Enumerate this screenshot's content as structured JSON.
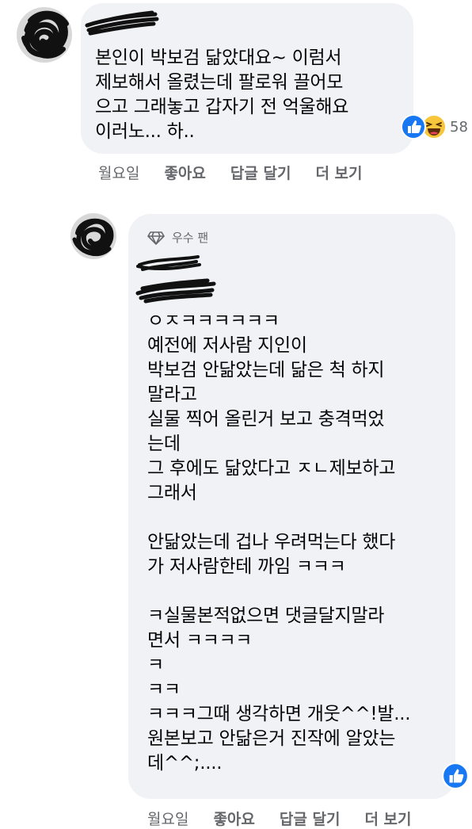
{
  "comments": [
    {
      "text": "본인이 박보검 닮았대요~ 이럼서\n제보해서 올렸는데 팔로워 끌어모\n으고 그래놓고 갑자기 전 억울해요\n이러노... 하..",
      "reaction_count": "58",
      "reactions": [
        "like-icon",
        "haha-icon"
      ],
      "actions": {
        "time": "월요일",
        "like": "좋아요",
        "reply": "답글 달기",
        "more": "더 보기"
      }
    },
    {
      "badge": "우수 팬",
      "text": "ㅇㅈㅋㅋㅋㅋㅋㅋ\n예전에 저사람 지인이\n박보검 안닮았는데 닮은 척 하지\n말라고\n실물 찍어 올린거 보고 충격먹었\n는데\n그 후에도 닮았다고 ㅈㄴ제보하고\n그래서\n\n안닮았는데 겁나 우려먹는다 했다\n가 저사람한테 까임 ㅋㅋㅋ\n\nㅋ실물본적없으면 댓글달지말라\n면서 ㅋㅋㅋㅋ\nㅋ\nㅋㅋ\nㅋㅋㅋ그때 생각하면 개웃^^!발...\n원본보고 안닮은거 진작에 알았는\n데^^;....",
      "reactions": [
        "like-icon"
      ],
      "actions": {
        "time": "월요일",
        "like": "좋아요",
        "reply": "답글 달기",
        "more": "더 보기"
      }
    }
  ],
  "colors": {
    "bubble": "#f0f2f5",
    "secondary_text": "#65676b",
    "like_blue": "#1877f2"
  }
}
